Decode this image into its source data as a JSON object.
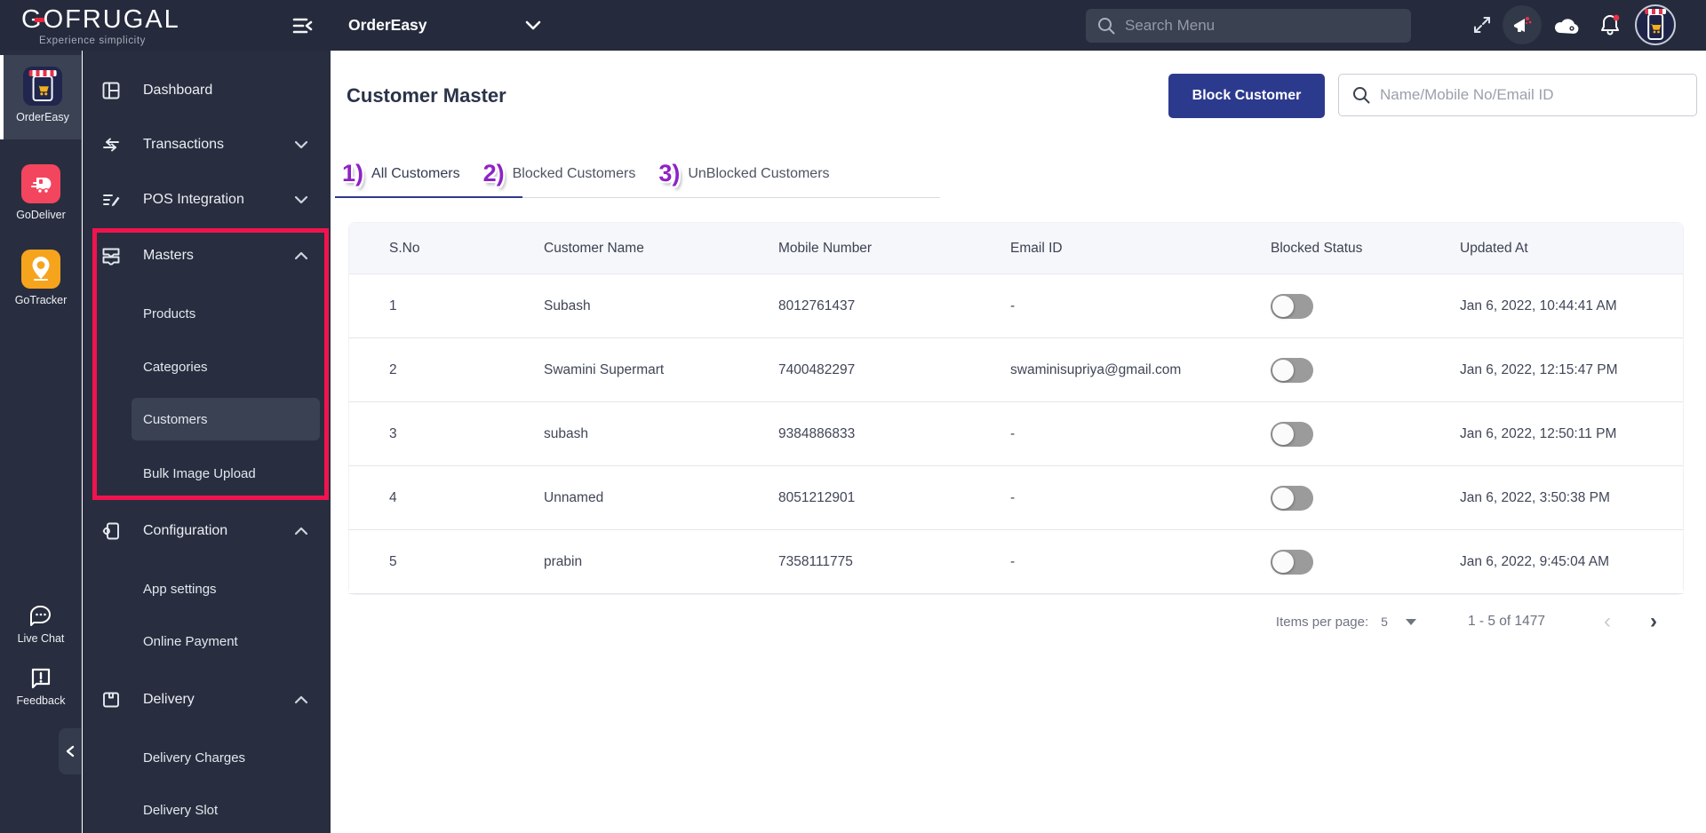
{
  "brand": {
    "logo_text": "OFRUGAL",
    "logo_first_letter": "G",
    "tagline": "Experience simplicity"
  },
  "topbar": {
    "product_selector": "OrderEasy",
    "search_placeholder": "Search Menu",
    "icons": [
      "collapse-menu-icon",
      "fullscreen-icon",
      "announcement-icon",
      "cloud-icon",
      "notification-bell-icon",
      "store-avatar-icon"
    ]
  },
  "rail": {
    "apps": [
      {
        "label": "OrderEasy",
        "selected": true
      },
      {
        "label": "GoDeliver",
        "selected": false
      },
      {
        "label": "GoTracker",
        "selected": false
      }
    ],
    "bottom": [
      {
        "label": "Live Chat"
      },
      {
        "label": "Feedback"
      }
    ]
  },
  "sidebar": {
    "items": [
      {
        "label": "Dashboard",
        "type": "parent"
      },
      {
        "label": "Transactions",
        "type": "parent",
        "chevron": "down"
      },
      {
        "label": "POS Integration",
        "type": "parent",
        "chevron": "down"
      },
      {
        "label": "Masters",
        "type": "parent",
        "chevron": "up",
        "expanded": true
      },
      {
        "label": "Products",
        "type": "child"
      },
      {
        "label": "Categories",
        "type": "child"
      },
      {
        "label": "Customers",
        "type": "child",
        "selected": true
      },
      {
        "label": "Bulk Image Upload",
        "type": "child"
      },
      {
        "label": "Configuration",
        "type": "parent",
        "chevron": "up",
        "expanded": true
      },
      {
        "label": "App settings",
        "type": "child"
      },
      {
        "label": "Online Payment",
        "type": "child"
      },
      {
        "label": "Delivery",
        "type": "parent",
        "chevron": "up",
        "expanded": true
      },
      {
        "label": "Delivery Charges",
        "type": "child"
      },
      {
        "label": "Delivery Slot",
        "type": "child"
      }
    ]
  },
  "page": {
    "title": "Customer Master",
    "block_button": "Block Customer",
    "search_placeholder": "Name/Mobile No/Email ID"
  },
  "tabs": [
    {
      "annotation": "1)",
      "label": "All Customers",
      "active": true
    },
    {
      "annotation": "2)",
      "label": "Blocked Customers",
      "active": false
    },
    {
      "annotation": "3)",
      "label": "UnBlocked Customers",
      "active": false
    }
  ],
  "table": {
    "columns": [
      "S.No",
      "Customer Name",
      "Mobile Number",
      "Email ID",
      "Blocked Status",
      "Updated At"
    ],
    "rows": [
      {
        "sno": "1",
        "name": "Subash",
        "mobile": "8012761437",
        "email": "-",
        "blocked": false,
        "updated": "Jan 6, 2022, 10:44:41 AM"
      },
      {
        "sno": "2",
        "name": "Swamini Supermart",
        "mobile": "7400482297",
        "email": "swaminisupriya@gmail.com",
        "blocked": false,
        "updated": "Jan 6, 2022, 12:15:47 PM"
      },
      {
        "sno": "3",
        "name": "subash",
        "mobile": "9384886833",
        "email": "-",
        "blocked": false,
        "updated": "Jan 6, 2022, 12:50:11 PM"
      },
      {
        "sno": "4",
        "name": "Unnamed",
        "mobile": "8051212901",
        "email": "-",
        "blocked": false,
        "updated": "Jan 6, 2022, 3:50:38 PM"
      },
      {
        "sno": "5",
        "name": "prabin",
        "mobile": "7358111775",
        "email": "-",
        "blocked": false,
        "updated": "Jan 6, 2022, 9:45:04 AM"
      }
    ]
  },
  "pagination": {
    "items_per_page_label": "Items per page:",
    "items_per_page_value": "5",
    "range": "1 - 5 of 1477"
  },
  "colors": {
    "topbar_bg": "#252b3c",
    "sidebar_bg": "#282e3f",
    "primary_button": "#2c3a8e",
    "annotation_purple": "#8d23c5",
    "highlight_red": "#f1134e",
    "logo_red": "#e8273e",
    "godeliver_red": "#f4455e",
    "gotracker_orange": "#f6a41d",
    "toggle_off_track": "#9b9b9b",
    "active_tab_underline": "#2d3a8c"
  }
}
